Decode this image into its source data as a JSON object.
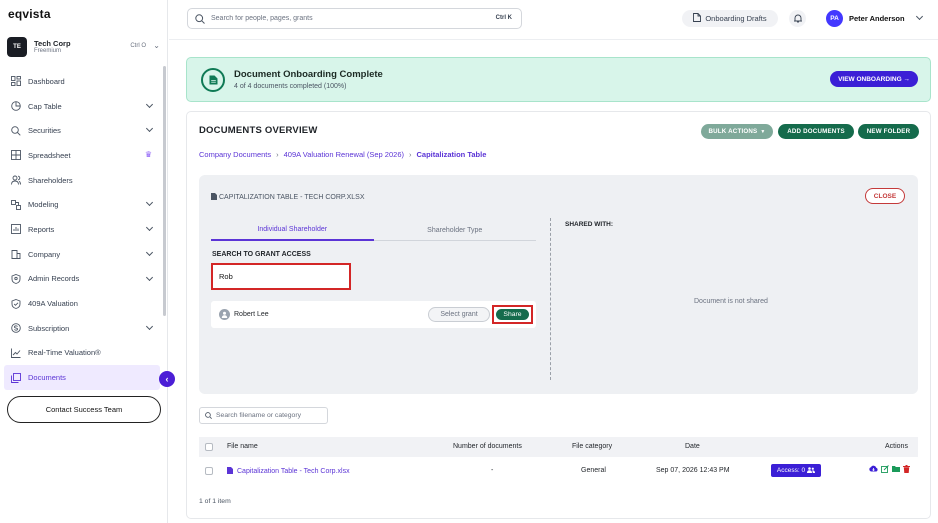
{
  "app": {
    "logo": "eqvista"
  },
  "company": {
    "initials": "TE",
    "name": "Tech Corp",
    "plan": "Freemium",
    "shortcut": "Ctrl O"
  },
  "sidebar": {
    "items": [
      {
        "label": "Dashboard",
        "icon": "dashboard-icon",
        "chevron": false
      },
      {
        "label": "Cap Table",
        "icon": "pie-chart-icon",
        "chevron": true
      },
      {
        "label": "Securities",
        "icon": "securities-icon",
        "chevron": true
      },
      {
        "label": "Spreadsheet",
        "icon": "spreadsheet-icon",
        "chevron": false,
        "badge": "crown-icon"
      },
      {
        "label": "Shareholders",
        "icon": "users-icon",
        "chevron": false
      },
      {
        "label": "Modeling",
        "icon": "modeling-icon",
        "chevron": true
      },
      {
        "label": "Reports",
        "icon": "reports-icon",
        "chevron": true
      },
      {
        "label": "Company",
        "icon": "company-icon",
        "chevron": true
      },
      {
        "label": "Admin Records",
        "icon": "admin-records-icon",
        "chevron": true
      },
      {
        "label": "409A Valuation",
        "icon": "shield-check-icon",
        "chevron": false
      },
      {
        "label": "Subscription",
        "icon": "subscription-icon",
        "chevron": true
      },
      {
        "label": "Real-Time Valuation®",
        "icon": "trend-icon",
        "chevron": false
      },
      {
        "label": "Documents",
        "icon": "documents-icon",
        "chevron": false,
        "active": true
      }
    ],
    "contact_button": "Contact Success Team"
  },
  "topbar": {
    "search_placeholder": "Search for people, pages, grants",
    "search_shortcut": "Ctrl K",
    "drafts_label": "Onboarding Drafts",
    "user_initials": "PA",
    "user_name": "Peter Anderson"
  },
  "banner": {
    "title": "Document Onboarding Complete",
    "subtitle": "4 of 4 documents completed (100%)",
    "button": "VIEW ONBOARDING →"
  },
  "documents": {
    "title": "DOCUMENTS OVERVIEW",
    "bulk_actions": "BULK ACTIONS",
    "add_documents": "ADD DOCUMENTS",
    "new_folder": "NEW FOLDER",
    "breadcrumb": [
      "Company Documents",
      "409A Valuation Renewal (Sep 2026)",
      "Capitalization Table"
    ]
  },
  "share_panel": {
    "file_title": "CAPITALIZATION TABLE - TECH CORP.XLSX",
    "close": "CLOSE",
    "tabs": [
      "Individual Shareholder",
      "Shareholder Type"
    ],
    "search_label": "SEARCH TO GRANT ACCESS",
    "search_value": "Rob",
    "result": {
      "name": "Robert Lee",
      "select_grant": "Select grant",
      "share": "Share"
    },
    "shared_with_label": "SHARED WITH:",
    "not_shared": "Document is not shared"
  },
  "table": {
    "search_placeholder": "Search filename or category",
    "headers": [
      "File name",
      "Number of documents",
      "File category",
      "Date",
      "Actions"
    ],
    "rows": [
      {
        "file_name": "Capitalization Table - Tech Corp.xlsx",
        "num_docs": "-",
        "category": "General",
        "date": "Sep 07, 2026 12:43 PM",
        "access": "Access: 0"
      }
    ],
    "pagination": "1 of 1 item"
  },
  "colors": {
    "accent": "#5b34d6",
    "green": "#156b4c",
    "danger": "#d32626",
    "banner_bg": "#d8f5ea"
  }
}
